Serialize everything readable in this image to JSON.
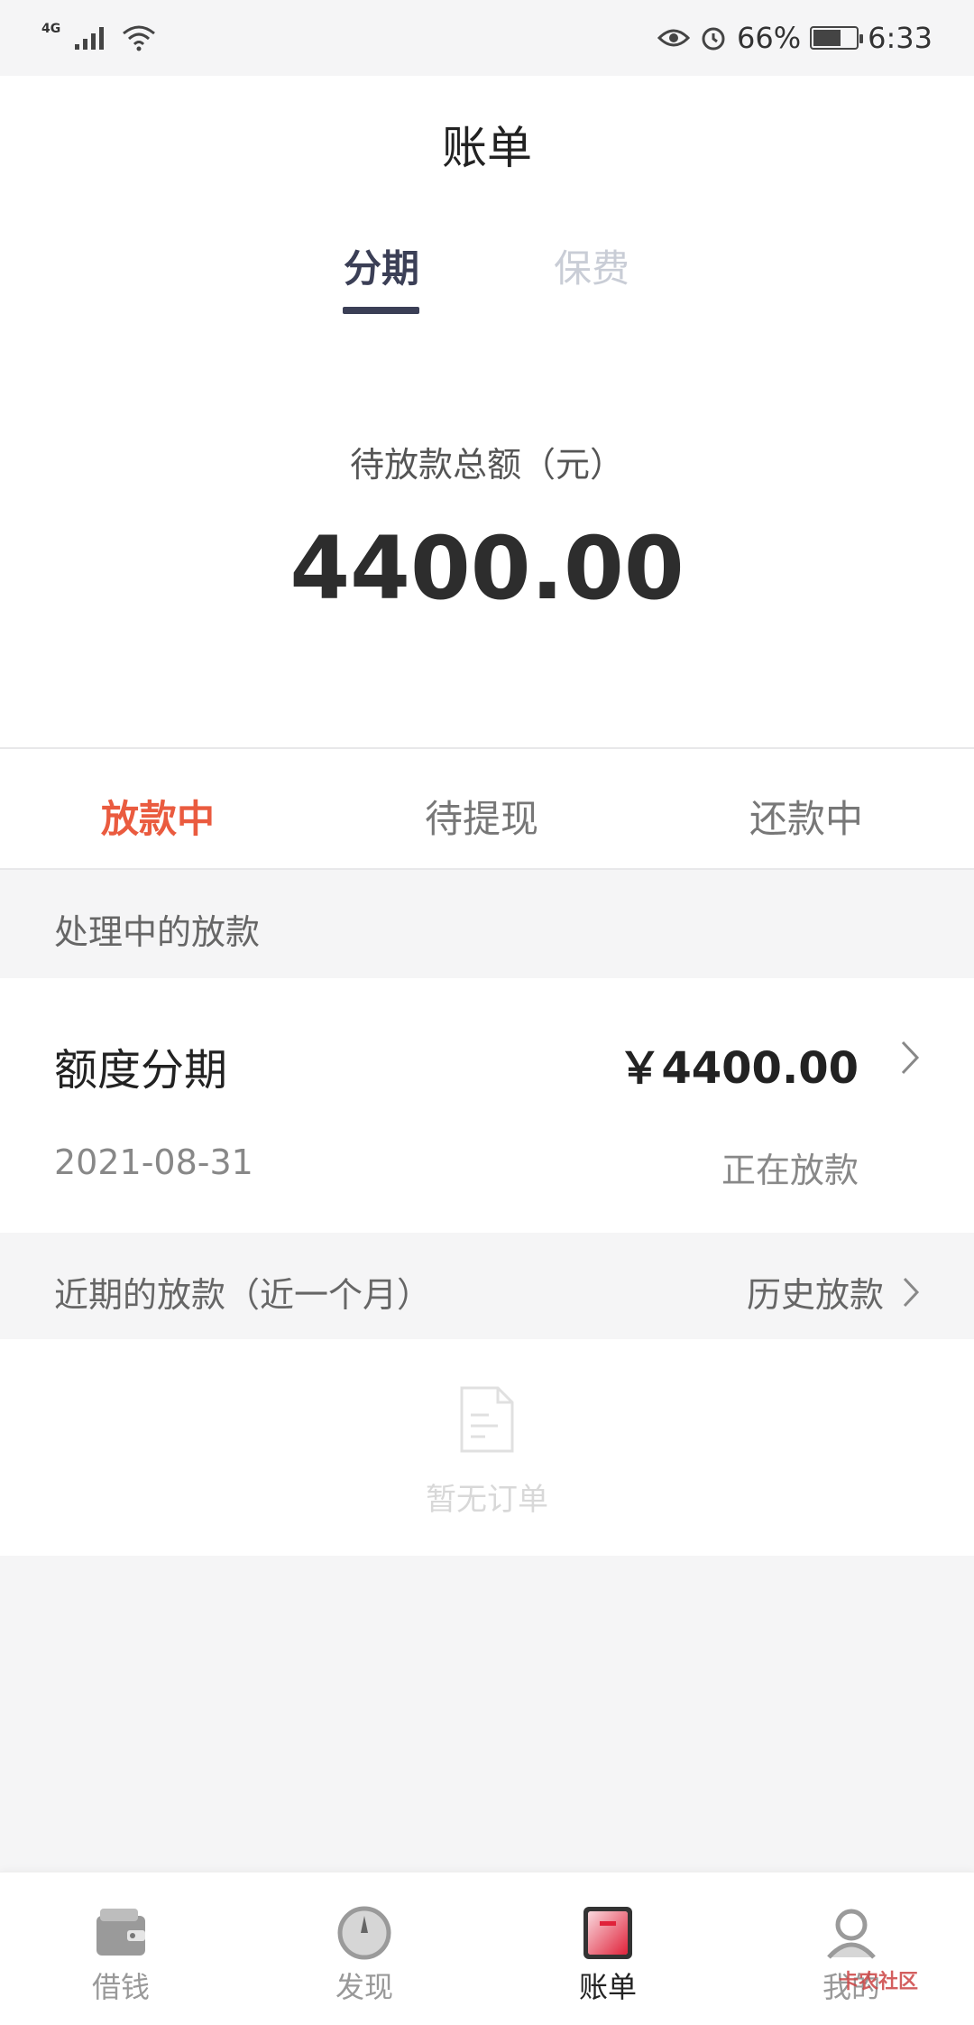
{
  "status_bar": {
    "network": "4G",
    "battery": "66%",
    "time": "6:33"
  },
  "header": {
    "title": "账单",
    "tabs": [
      {
        "label": "分期",
        "active": true
      },
      {
        "label": "保费",
        "active": false
      }
    ]
  },
  "summary": {
    "label": "待放款总额（元）",
    "amount": "4400.00"
  },
  "status_tabs": [
    {
      "label": "放款中",
      "active": true
    },
    {
      "label": "待提现",
      "active": false
    },
    {
      "label": "还款中",
      "active": false
    }
  ],
  "processing": {
    "section_title": "处理中的放款",
    "item": {
      "name": "额度分期",
      "amount": "￥4400.00",
      "date": "2021-08-31",
      "status": "正在放款"
    }
  },
  "recent": {
    "section_title": "近期的放款（近一个月）",
    "history_link": "历史放款",
    "empty_text": "暂无订单"
  },
  "bottom_nav": [
    {
      "label": "借钱",
      "icon": "wallet-icon"
    },
    {
      "label": "发现",
      "icon": "compass-icon"
    },
    {
      "label": "账单",
      "icon": "bill-icon",
      "active": true
    },
    {
      "label": "我的",
      "icon": "user-icon"
    }
  ],
  "watermark": "卡农社区",
  "colors": {
    "accent": "#ea5b3f",
    "tab_active": "#3b3f56",
    "tab_inactive": "#c9cdd6"
  }
}
